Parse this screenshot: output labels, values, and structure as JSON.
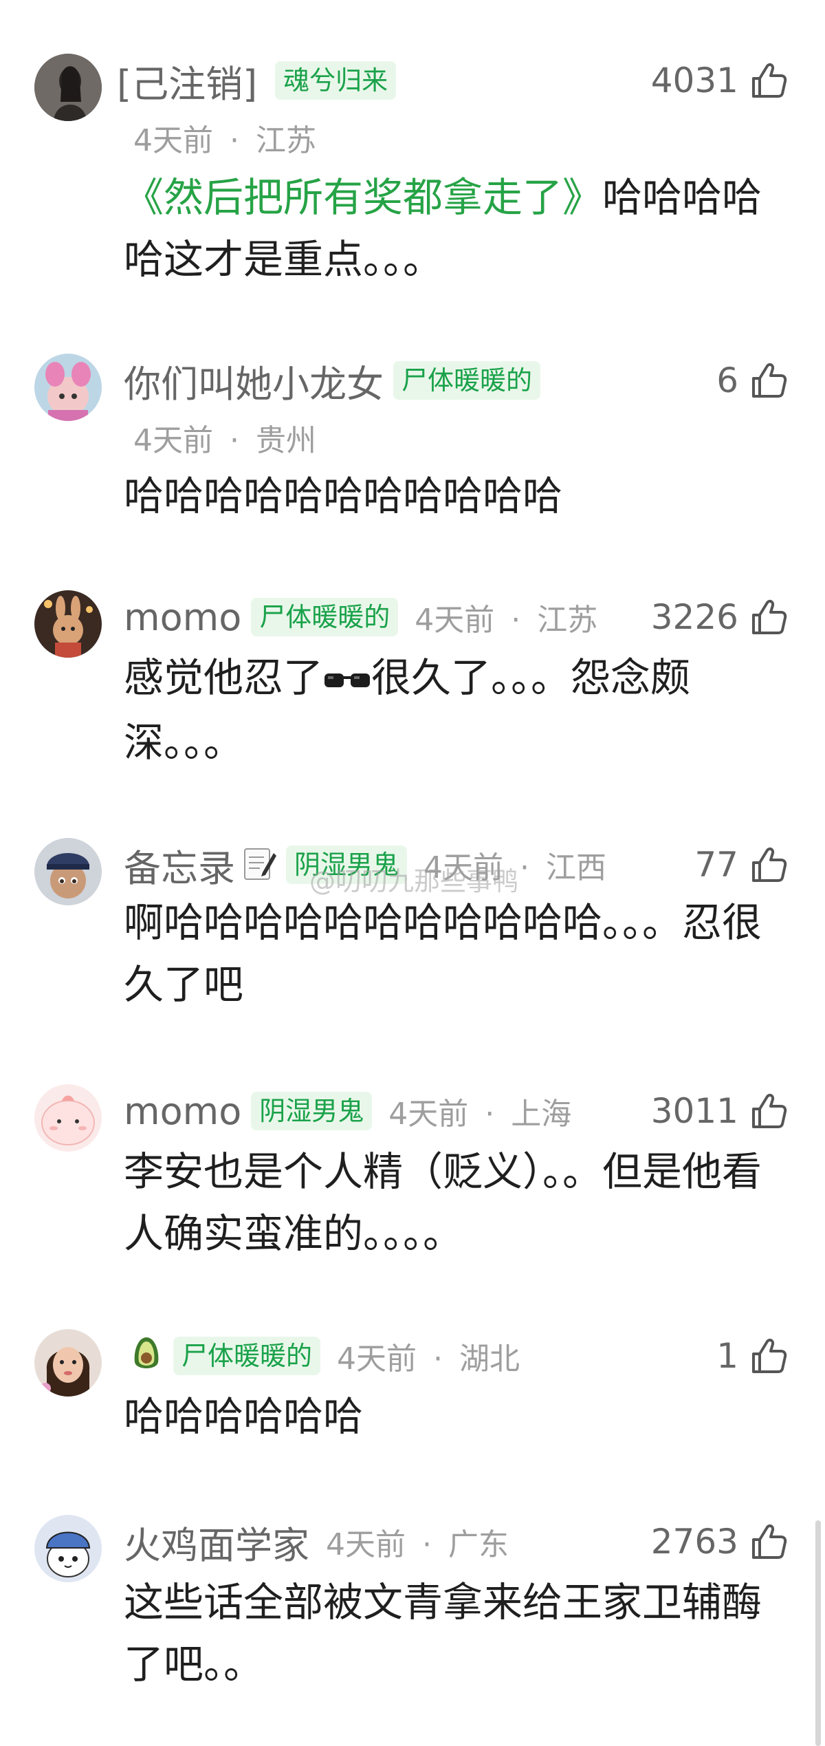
{
  "comments": [
    {
      "username": "[己注销]",
      "badge": "魂兮归来",
      "time": "4天前",
      "location": "江苏",
      "time_loc_sep": "·",
      "likes": "4031",
      "text_green": "《然后把所有奖都拿走了》",
      "text": "哈哈哈哈哈这才是重点。。。",
      "avatar_icon": "person-dark-avatar"
    },
    {
      "username": "你们叫她小龙女",
      "badge": "尸体暖暖的",
      "time": "4天前",
      "location": "贵州",
      "time_loc_sep": "·",
      "likes": "6",
      "text": "哈哈哈哈哈哈哈哈哈哈哈",
      "avatar_icon": "pink-toy-avatar"
    },
    {
      "username": "momo",
      "badge": "尸体暖暖的",
      "time": "4天前",
      "location": "江苏",
      "time_loc_sep": "·",
      "likes": "3226",
      "text_before": "感觉他忍了",
      "emoji": "sunglasses-emoji",
      "text_after": "很久了。。。怨念颇深。。。",
      "avatar_icon": "bunny-toy-avatar"
    },
    {
      "username": "备忘录",
      "username_emoji": "memo-emoji",
      "badge": "阴湿男鬼",
      "time": "4天前",
      "location": "江西",
      "time_loc_sep": "·",
      "likes": "77",
      "text": "啊哈哈哈哈哈哈哈哈哈哈哈。。。忍很久了吧",
      "avatar_icon": "cartoon-cop-avatar"
    },
    {
      "username": "momo",
      "badge": "阴湿男鬼",
      "time": "4天前",
      "location": "上海",
      "time_loc_sep": "·",
      "likes": "3011",
      "text": "李安也是个人精（贬义）。。但是他看人确实蛮准的。。。。",
      "avatar_icon": "pink-blob-avatar"
    },
    {
      "username_emoji": "avocado-emoji",
      "badge": "尸体暖暖的",
      "time": "4天前",
      "location": "湖北",
      "time_loc_sep": "·",
      "likes": "1",
      "text": "哈哈哈哈哈哈",
      "avatar_icon": "girl-photo-avatar"
    },
    {
      "username": "火鸡面学家",
      "time": "4天前",
      "location": "广东",
      "time_loc_sep": "·",
      "likes": "2763",
      "text": "这些话全部被文青拿来给王家卫辅酶了吧。。",
      "avatar_icon": "blue-hat-cartoon-avatar"
    }
  ],
  "watermark": "@叨叨九那些事鸭",
  "icons": {
    "like": "thumbs-up-icon"
  },
  "colors": {
    "badge_bg": "#e9f7ea",
    "badge_text": "#1aa24a",
    "green_quote": "#26a346",
    "muted": "#9e9e9e"
  }
}
